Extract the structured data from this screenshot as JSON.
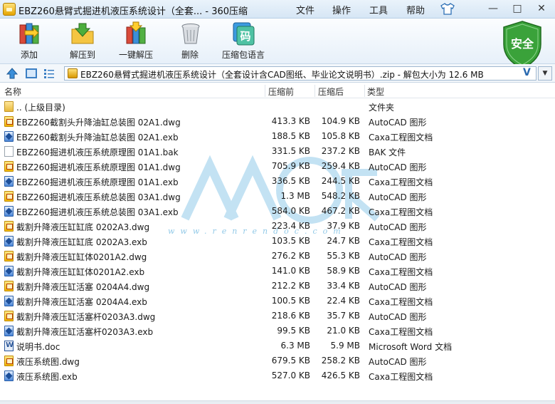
{
  "window": {
    "title": "EBZ260悬臂式掘进机液压系统设计（全套... - 360压缩",
    "menus": [
      "文件",
      "操作",
      "工具",
      "帮助"
    ],
    "controls": {
      "minimize": "—",
      "maximize": "□",
      "close": "✕"
    }
  },
  "toolbar": {
    "buttons": [
      {
        "label": "添加",
        "icon": "add-books-icon"
      },
      {
        "label": "解压到",
        "icon": "extract-folder-icon"
      },
      {
        "label": "一键解压",
        "icon": "one-click-extract-icon"
      },
      {
        "label": "删除",
        "icon": "trash-can-icon"
      },
      {
        "label": "压缩包语言",
        "icon": "archive-language-icon"
      }
    ],
    "security_badge": "安全"
  },
  "address": {
    "path": "EBZ260悬臂式掘进机液压系统设计（全套设计含CAD图纸、毕业论文说明书）.zip - 解包大小为 12.6 MB",
    "search_key": "V"
  },
  "columns": {
    "name": "名称",
    "packed": "压缩前",
    "unpacked": "压缩后",
    "type": "类型"
  },
  "files": [
    {
      "name": ".. (上级目录)",
      "packed": "",
      "unpacked": "",
      "type": "文件夹",
      "icon": "folder"
    },
    {
      "name": "EBZ260截割头升降油缸总装图 02A1.dwg",
      "packed": "413.3 KB",
      "unpacked": "104.9 KB",
      "type": "AutoCAD 图形",
      "icon": "dwg"
    },
    {
      "name": "EBZ260截割头升降油缸总装图 02A1.exb",
      "packed": "188.5 KB",
      "unpacked": "105.8 KB",
      "type": "Caxa工程图文档",
      "icon": "exb"
    },
    {
      "name": "EBZ260掘进机液压系统原理图 01A1.bak",
      "packed": "331.5 KB",
      "unpacked": "237.2 KB",
      "type": "BAK 文件",
      "icon": "bak"
    },
    {
      "name": "EBZ260掘进机液压系统原理图 01A1.dwg",
      "packed": "705.9 KB",
      "unpacked": "259.4 KB",
      "type": "AutoCAD 图形",
      "icon": "dwg"
    },
    {
      "name": "EBZ260掘进机液压系统原理图 01A1.exb",
      "packed": "336.5 KB",
      "unpacked": "244.5 KB",
      "type": "Caxa工程图文档",
      "icon": "exb"
    },
    {
      "name": "EBZ260掘进机液压系统总装图 03A1.dwg",
      "packed": "1.3 MB",
      "unpacked": "548.2 KB",
      "type": "AutoCAD 图形",
      "icon": "dwg"
    },
    {
      "name": "EBZ260掘进机液压系统总装图 03A1.exb",
      "packed": "584.0 KB",
      "unpacked": "467.2 KB",
      "type": "Caxa工程图文档",
      "icon": "exb"
    },
    {
      "name": "截割升降液压缸缸底 0202A3.dwg",
      "packed": "223.4 KB",
      "unpacked": "37.9 KB",
      "type": "AutoCAD 图形",
      "icon": "dwg"
    },
    {
      "name": "截割升降液压缸缸底 0202A3.exb",
      "packed": "103.5 KB",
      "unpacked": "24.7 KB",
      "type": "Caxa工程图文档",
      "icon": "exb"
    },
    {
      "name": "截割升降液压缸缸体0201A2.dwg",
      "packed": "276.2 KB",
      "unpacked": "55.3 KB",
      "type": "AutoCAD 图形",
      "icon": "dwg"
    },
    {
      "name": "截割升降液压缸缸体0201A2.exb",
      "packed": "141.0 KB",
      "unpacked": "58.9 KB",
      "type": "Caxa工程图文档",
      "icon": "exb"
    },
    {
      "name": "截割升降液压缸活塞 0204A4.dwg",
      "packed": "212.2 KB",
      "unpacked": "33.4 KB",
      "type": "AutoCAD 图形",
      "icon": "dwg"
    },
    {
      "name": "截割升降液压缸活塞 0204A4.exb",
      "packed": "100.5 KB",
      "unpacked": "22.4 KB",
      "type": "Caxa工程图文档",
      "icon": "exb"
    },
    {
      "name": "截割升降液压缸活塞杆0203A3.dwg",
      "packed": "218.6 KB",
      "unpacked": "35.7 KB",
      "type": "AutoCAD 图形",
      "icon": "dwg"
    },
    {
      "name": "截割升降液压缸活塞杆0203A3.exb",
      "packed": "99.5 KB",
      "unpacked": "21.0 KB",
      "type": "Caxa工程图文档",
      "icon": "exb"
    },
    {
      "name": "说明书.doc",
      "packed": "6.3 MB",
      "unpacked": "5.9 MB",
      "type": "Microsoft Word 文档",
      "icon": "doc"
    },
    {
      "name": "液压系统图.dwg",
      "packed": "679.5 KB",
      "unpacked": "258.2 KB",
      "type": "AutoCAD 图形",
      "icon": "dwg"
    },
    {
      "name": "液压系统图.exb",
      "packed": "527.0 KB",
      "unpacked": "426.5 KB",
      "type": "Caxa工程图文档",
      "icon": "exb"
    }
  ],
  "watermark": {
    "text": "www.renrendoc.com",
    "icon": "renrendoc-watermark-icon"
  },
  "colors": {
    "accent": "#3b7fc4",
    "security_green": "#3aa23a"
  }
}
